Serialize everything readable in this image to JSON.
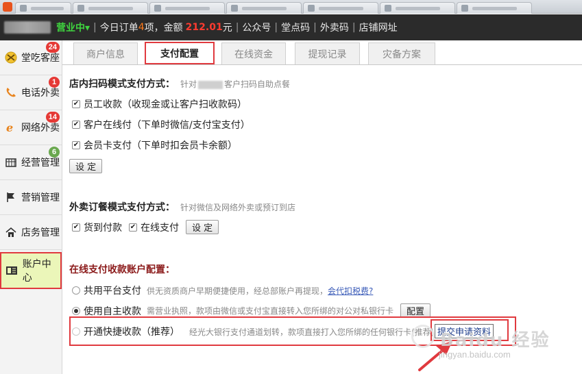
{
  "topbar": {
    "status": "营业中▾",
    "today_orders_prefix": "今日订单",
    "order_count": "4",
    "order_unit_amount": "项，金额",
    "amount": "212.01",
    "amount_unit": "元",
    "links": [
      "公众号",
      "堂点码",
      "外卖码",
      "店铺网址"
    ],
    "separator": "|"
  },
  "sidebar": {
    "items": [
      {
        "label": "堂吃客座",
        "icon": "dine-in-icon",
        "badge": "24",
        "badge_color": "#e53935"
      },
      {
        "label": "电话外卖",
        "icon": "phone-icon",
        "badge": "1",
        "badge_color": "#e53935"
      },
      {
        "label": "网络外卖",
        "icon": "ie-icon",
        "badge": "14",
        "badge_color": "#e53935"
      },
      {
        "label": "经营管理",
        "icon": "calendar-icon",
        "badge": "6",
        "badge_color": "#6aa84f"
      },
      {
        "label": "营销管理",
        "icon": "flag-icon",
        "badge": "",
        "badge_color": ""
      },
      {
        "label": "店务管理",
        "icon": "home-icon",
        "badge": "",
        "badge_color": ""
      },
      {
        "label": "账户中心",
        "icon": "card-icon",
        "badge": "",
        "badge_color": "",
        "active": true
      }
    ]
  },
  "tabs": [
    {
      "label": "商户信息",
      "active": false
    },
    {
      "label": "支付配置",
      "active": true
    },
    {
      "label": "在线资金",
      "active": false
    },
    {
      "label": "提现记录",
      "active": false
    },
    {
      "label": "灾备方案",
      "active": false
    }
  ],
  "section_instore": {
    "title": "店内扫码模式支付方式：",
    "hint_prefix": "针对",
    "hint_suffix": "客户扫码自助点餐",
    "options": [
      {
        "label": "员工收款（收现金或让客户扫收款码）",
        "checked": true
      },
      {
        "label": "客户在线付（下单时微信/支付宝支付）",
        "checked": true
      },
      {
        "label": "会员卡支付（下单时扣会员卡余额）",
        "checked": true
      }
    ],
    "set_button": "设 定"
  },
  "section_takeout": {
    "title": "外卖订餐模式支付方式：",
    "hint": "针对微信及网络外卖或预订到店",
    "options": [
      {
        "label": "货到付款",
        "checked": true
      },
      {
        "label": "在线支付",
        "checked": true
      }
    ],
    "set_button": "设 定"
  },
  "section_online": {
    "title": "在线支付收款账户配置：",
    "options": [
      {
        "label": "共用平台支付",
        "desc": "供无资质商户早期便捷使用，经总部账户再提现，",
        "link": "会代扣税费?",
        "selected": false
      },
      {
        "label": "使用自主收款",
        "desc": "需营业执照，款项由微信或支付宝直接转入您所绑的对公对私银行卡",
        "button": "配置",
        "selected": true
      },
      {
        "label": "开通快捷收款（推荐）",
        "desc": "经光大银行支付通道划转，款项直接打入您所绑的任何银行卡(推荐)",
        "button": "提交申请资料",
        "selected": false
      }
    ]
  },
  "watermark": {
    "text": "Baidu 经验",
    "url": "jingyan.baidu.com"
  },
  "colors": {
    "topbar_bg": "#2b2b2b",
    "status_green": "#3fd43f",
    "highlight_red": "#e0393e",
    "active_sidebar_bg": "#ebf6b9",
    "section_maroon": "#8b1a1a",
    "link_blue": "#3a5bb8"
  }
}
